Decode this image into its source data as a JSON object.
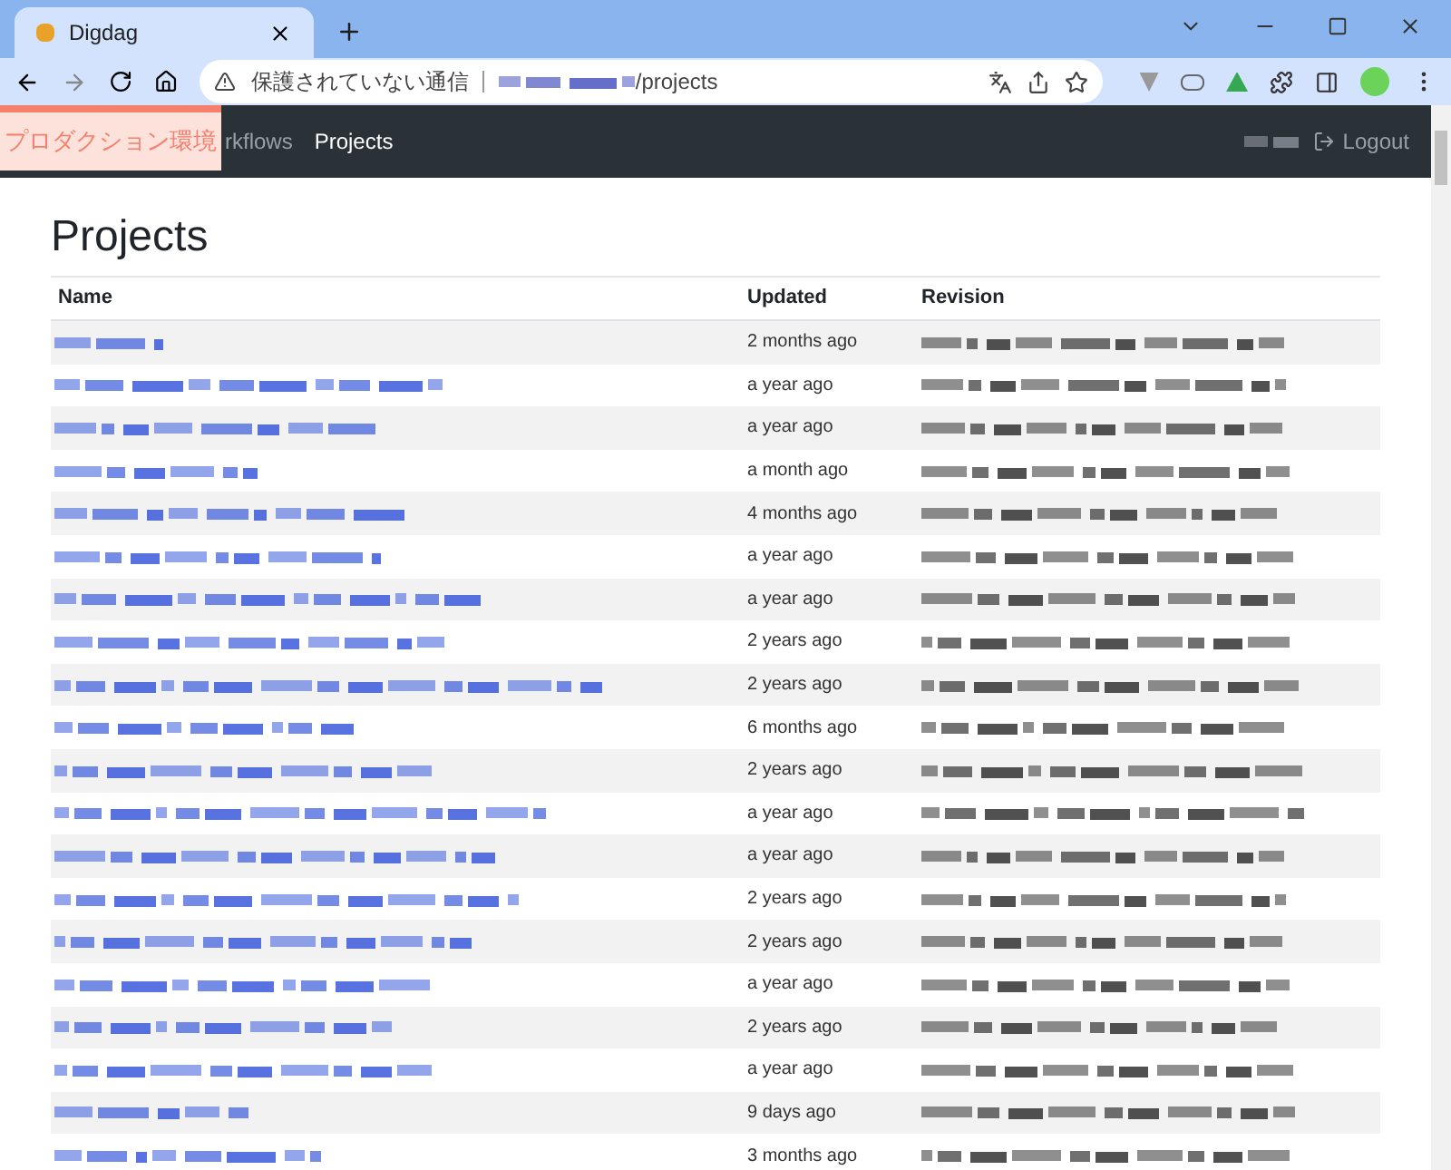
{
  "browser": {
    "tab_title": "Digdag",
    "security_label": "保護されていない通信",
    "url_path": "/projects"
  },
  "banner": {
    "label": "プロダクション環境"
  },
  "navbar": {
    "items": [
      {
        "label": "rkflows",
        "selected": false
      },
      {
        "label": "Projects",
        "selected": true
      }
    ],
    "logout": "Logout"
  },
  "page": {
    "title": "Projects"
  },
  "table": {
    "columns": [
      "Name",
      "Updated",
      "Revision"
    ],
    "rows": [
      {
        "updated": "2 months ago"
      },
      {
        "updated": "a year ago"
      },
      {
        "updated": "a year ago"
      },
      {
        "updated": "a month ago"
      },
      {
        "updated": "4 months ago"
      },
      {
        "updated": "a year ago"
      },
      {
        "updated": "a year ago"
      },
      {
        "updated": "2 years ago"
      },
      {
        "updated": "2 years ago"
      },
      {
        "updated": "6 months ago"
      },
      {
        "updated": "2 years ago"
      },
      {
        "updated": "a year ago"
      },
      {
        "updated": "a year ago"
      },
      {
        "updated": "2 years ago"
      },
      {
        "updated": "2 years ago"
      },
      {
        "updated": "a year ago"
      },
      {
        "updated": "2 years ago"
      },
      {
        "updated": "a year ago"
      },
      {
        "updated": "9 days ago"
      },
      {
        "updated": "3 months ago"
      }
    ]
  }
}
